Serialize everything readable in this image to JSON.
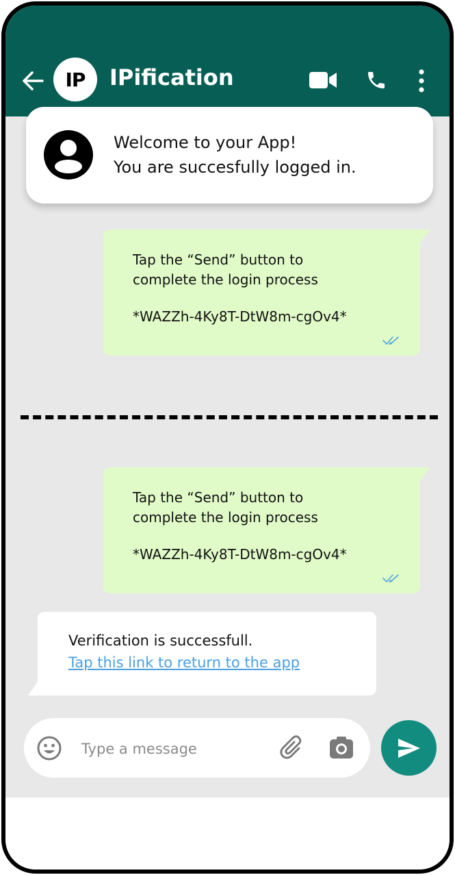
{
  "header": {
    "avatar_text": "IP",
    "title": "IPification",
    "icons": [
      "back-arrow-icon",
      "video-camera-icon",
      "phone-icon",
      "more-vertical-icon"
    ]
  },
  "notification": {
    "line1": "Welcome to your App!",
    "line2": "You are succesfully logged in.",
    "icon": "user-icon"
  },
  "messages": [
    {
      "line1": "Tap the “Send” button to",
      "line2": "complete the login process",
      "code": "*WAZZh-4Ky8T-DtW8m-cgOv4*"
    },
    {
      "line1": "Tap the “Send” button to",
      "line2": "complete the login process",
      "code": "*WAZZh-4Ky8T-DtW8m-cgOv4*"
    }
  ],
  "reply": {
    "text": "Verification is successfull.",
    "link": "Tap this link to return to the app"
  },
  "composer": {
    "placeholder": "Type a message",
    "icons": [
      "emoji-icon",
      "paperclip-icon",
      "camera-icon",
      "send-icon"
    ]
  },
  "colors": {
    "header": "#075E54",
    "chat_bg": "#E8E8E8",
    "outgoing_bubble": "#E1FBC8",
    "send_button": "#128C7E",
    "link": "#4A9FE0",
    "read_ticks": "#4FA3E0"
  }
}
